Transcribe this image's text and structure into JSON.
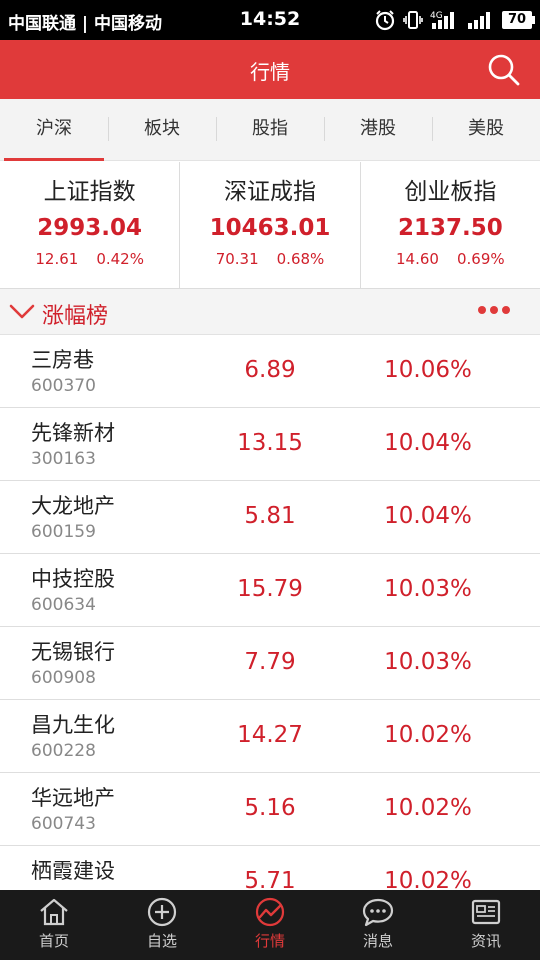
{
  "status_bar": {
    "carrier": "中国联通 | 中国移动",
    "time": "14:52",
    "network": "4G",
    "battery": "70"
  },
  "header": {
    "title": "行情"
  },
  "market_tabs": [
    {
      "label": "沪深",
      "active": true
    },
    {
      "label": "板块",
      "active": false
    },
    {
      "label": "股指",
      "active": false
    },
    {
      "label": "港股",
      "active": false
    },
    {
      "label": "美股",
      "active": false
    }
  ],
  "indices": [
    {
      "name": "上证指数",
      "value": "2993.04",
      "change": "12.61",
      "percent": "0.42%"
    },
    {
      "name": "深证成指",
      "value": "10463.01",
      "change": "70.31",
      "percent": "0.68%"
    },
    {
      "name": "创业板指",
      "value": "2137.50",
      "change": "14.60",
      "percent": "0.69%"
    }
  ],
  "rank": {
    "title": "涨幅榜",
    "rows": [
      {
        "name": "三房巷",
        "code": "600370",
        "price": "6.89",
        "change": "10.06%"
      },
      {
        "name": "先锋新材",
        "code": "300163",
        "price": "13.15",
        "change": "10.04%"
      },
      {
        "name": "大龙地产",
        "code": "600159",
        "price": "5.81",
        "change": "10.04%"
      },
      {
        "name": "中技控股",
        "code": "600634",
        "price": "15.79",
        "change": "10.03%"
      },
      {
        "name": "无锡银行",
        "code": "600908",
        "price": "7.79",
        "change": "10.03%"
      },
      {
        "name": "昌九生化",
        "code": "600228",
        "price": "14.27",
        "change": "10.02%"
      },
      {
        "name": "华远地产",
        "code": "600743",
        "price": "5.16",
        "change": "10.02%"
      },
      {
        "name": "栖霞建设",
        "code": "",
        "price": "5.71",
        "change": "10.02%"
      }
    ]
  },
  "bottom_nav": [
    {
      "label": "首页",
      "icon": "home-icon",
      "active": false
    },
    {
      "label": "自选",
      "icon": "plus-circle-icon",
      "active": false
    },
    {
      "label": "行情",
      "icon": "market-chart-icon",
      "active": true
    },
    {
      "label": "消息",
      "icon": "message-icon",
      "active": false
    },
    {
      "label": "资讯",
      "icon": "news-icon",
      "active": false
    }
  ],
  "colors": {
    "brand_red": "#e03a3a",
    "rise_red": "#d0202b",
    "nav_background": "#1a1a1a"
  }
}
